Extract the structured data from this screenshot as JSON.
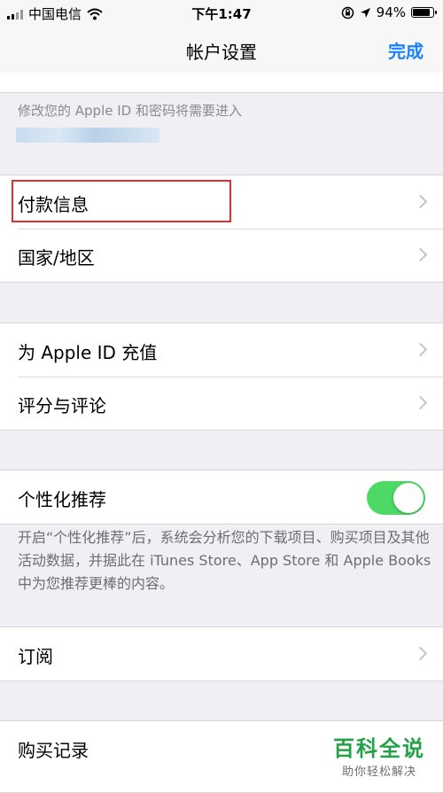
{
  "status_bar": {
    "carrier": "中国电信",
    "time": "下午1:47",
    "battery": "94%",
    "battery_level": 0.94,
    "icons": [
      "signal-icon",
      "wifi-icon",
      "orientation-lock-icon",
      "location-icon",
      "battery-icon"
    ]
  },
  "nav": {
    "title": "帐户设置",
    "done": "完成"
  },
  "top_note": "修改您的 Apple ID 和密码将需要进入",
  "section1": {
    "rows": [
      {
        "label": "付款信息"
      },
      {
        "label": "国家/地区"
      }
    ]
  },
  "section2": {
    "rows": [
      {
        "label": "为 Apple ID 充值"
      },
      {
        "label": "评分与评论"
      }
    ]
  },
  "section3": {
    "label": "个性化推荐",
    "toggle_on": true,
    "footnote": "开启“个性化推荐”后，系统会分析您的下载项目、购买项目及其他活动数据，并据此在 iTunes Store、App Store 和 Apple Books 中为您推荐更棒的内容。"
  },
  "section4": {
    "label": "订阅"
  },
  "section5": {
    "label": "购买记录"
  },
  "watermark": {
    "main": "百科全说",
    "sub": "助你轻松解决"
  },
  "colors": {
    "accent": "#1a82fb",
    "toggle": "#4cd964",
    "highlight": "#e0312f",
    "watermark": "#24a148"
  }
}
